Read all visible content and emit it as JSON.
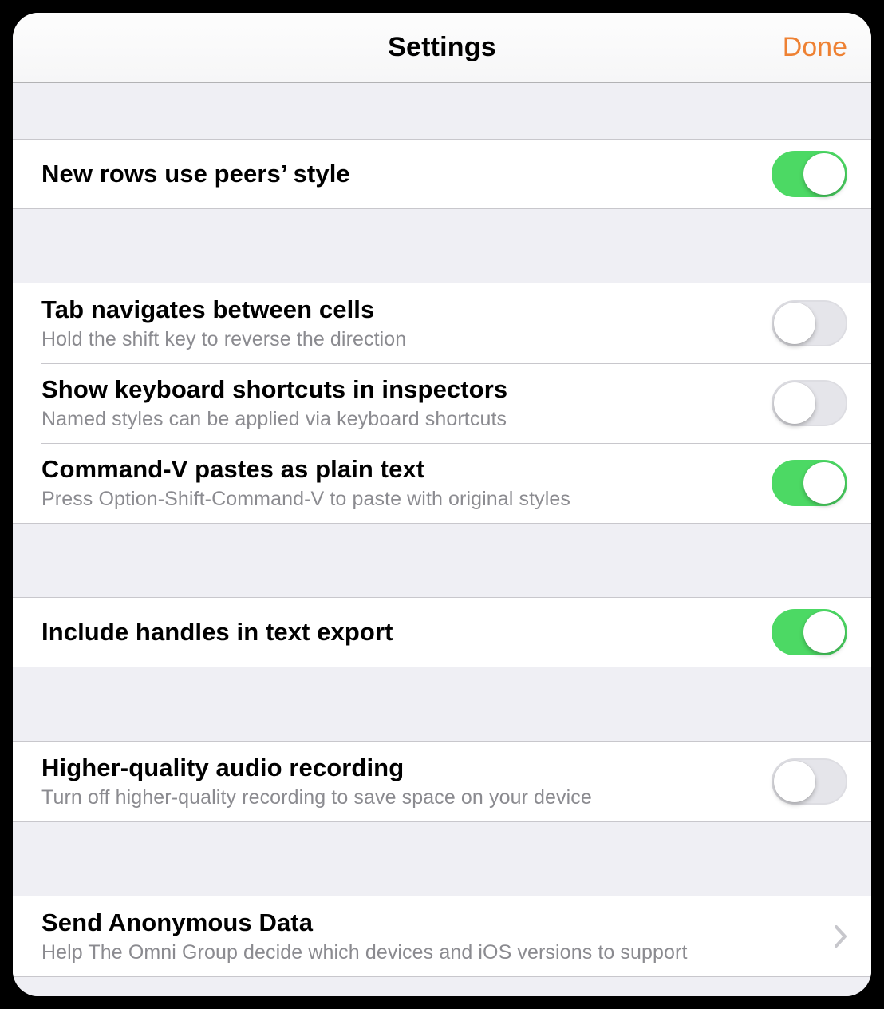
{
  "nav": {
    "title": "Settings",
    "done": "Done"
  },
  "groups": {
    "g1": {
      "peers_style": {
        "title": "New rows use peers’ style",
        "on": true
      }
    },
    "g2": {
      "tab_nav": {
        "title": "Tab navigates between cells",
        "sub": "Hold the shift key to reverse the direction",
        "on": false
      },
      "kb_shortcuts": {
        "title": "Show keyboard shortcuts in inspectors",
        "sub": "Named styles can be applied via keyboard shortcuts",
        "on": false
      },
      "paste_plain": {
        "title": "Command-V pastes as plain text",
        "sub": "Press Option-Shift-Command-V to paste with original styles",
        "on": true
      }
    },
    "g3": {
      "handles_export": {
        "title": "Include handles in text export",
        "on": true
      }
    },
    "g4": {
      "hq_audio": {
        "title": "Higher-quality audio recording",
        "sub": "Turn off higher-quality recording to save space on your device",
        "on": false
      }
    },
    "g5": {
      "anon_data": {
        "title": "Send Anonymous Data",
        "sub": "Help The Omni Group decide which devices and iOS versions to support"
      }
    }
  }
}
